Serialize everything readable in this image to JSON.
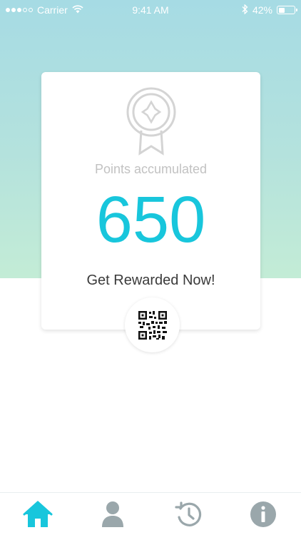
{
  "status_bar": {
    "carrier": "Carrier",
    "time": "9:41 AM",
    "battery": "42%",
    "battery_level": 0.42
  },
  "card": {
    "icon": "award-ribbon-icon",
    "points_label": "Points accumulated",
    "points_value": "650",
    "cta": "Get Rewarded Now!"
  },
  "qr": {
    "icon": "qr-code-icon"
  },
  "tabs": [
    {
      "icon": "home-icon",
      "active": true
    },
    {
      "icon": "profile-icon",
      "active": false
    },
    {
      "icon": "history-icon",
      "active": false
    },
    {
      "icon": "info-icon",
      "active": false
    }
  ],
  "colors": {
    "accent": "#18c6dc",
    "inactive_icon": "#9aa7ab",
    "gradient_top": "#a6dbe4",
    "gradient_bottom": "#c3ecd6"
  }
}
